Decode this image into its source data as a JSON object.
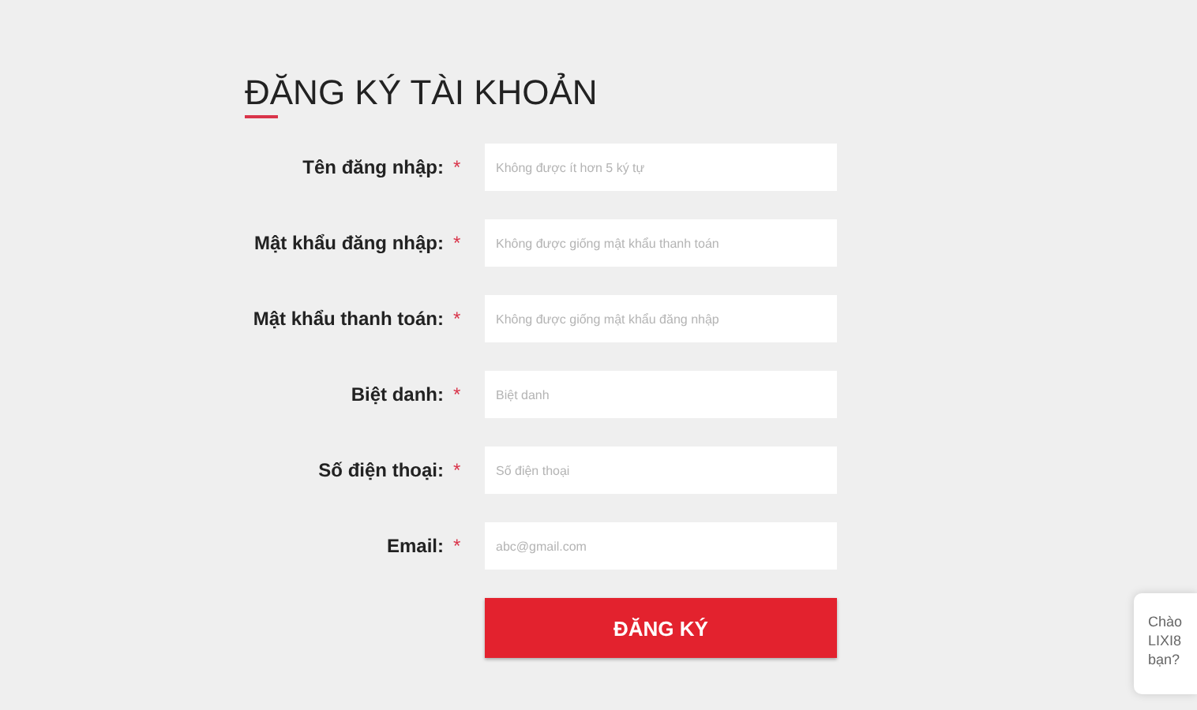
{
  "title": "ĐĂNG KÝ TÀI KHOẢN",
  "fields": [
    {
      "label": "Tên đăng nhập:",
      "required_mark": "*",
      "placeholder": "Không được ít hơn 5 ký tự"
    },
    {
      "label": "Mật khẩu đăng nhập:",
      "required_mark": "*",
      "placeholder": "Không được giống mật khẩu thanh toán"
    },
    {
      "label": "Mật khẩu thanh toán:",
      "required_mark": "*",
      "placeholder": "Không được giống mật khẩu đăng nhập"
    },
    {
      "label": "Biệt danh:",
      "required_mark": "*",
      "placeholder": "Biệt danh"
    },
    {
      "label": "Số điện thoại:",
      "required_mark": "*",
      "placeholder": "Số điện thoại"
    },
    {
      "label": "Email:",
      "required_mark": "*",
      "placeholder": "abc@gmail.com"
    }
  ],
  "submit": "ĐĂNG KÝ",
  "chat_bubble": {
    "lines": [
      "Chào",
      "LIXI8",
      "bạn?"
    ]
  }
}
